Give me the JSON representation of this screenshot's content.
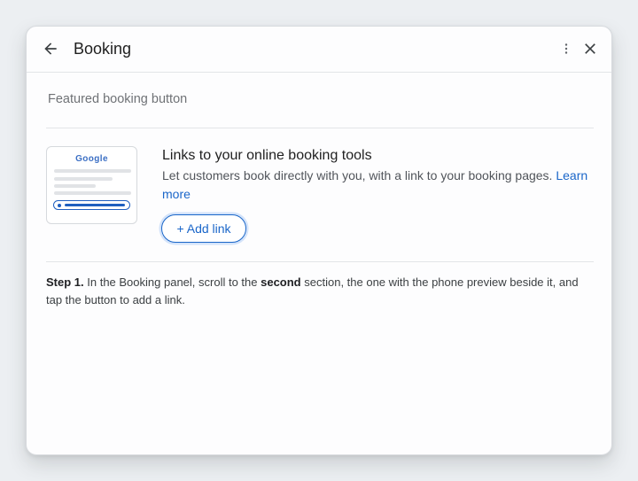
{
  "header": {
    "title": "Booking",
    "icons": {
      "back": "back-arrow-icon",
      "more": "more-vert-icon",
      "close": "close-icon"
    }
  },
  "section": {
    "title": "Featured booking button"
  },
  "feature": {
    "thumbnail_logo": "Google",
    "title": "Links to your online booking tools",
    "description": "Let customers book directly with you, with a link to your booking pages.",
    "learn_more": "Learn more",
    "add_link_label": "+ Add link"
  },
  "step": {
    "label": "Step 1.",
    "text_1": "In the Booking panel, scroll to the",
    "emphasis": "second",
    "text_2": "section, the one with the phone preview beside it, and tap the button to add a link."
  },
  "colors": {
    "accent": "#1a66c9",
    "background": "#eceff2",
    "card": "#fdfdfe"
  }
}
